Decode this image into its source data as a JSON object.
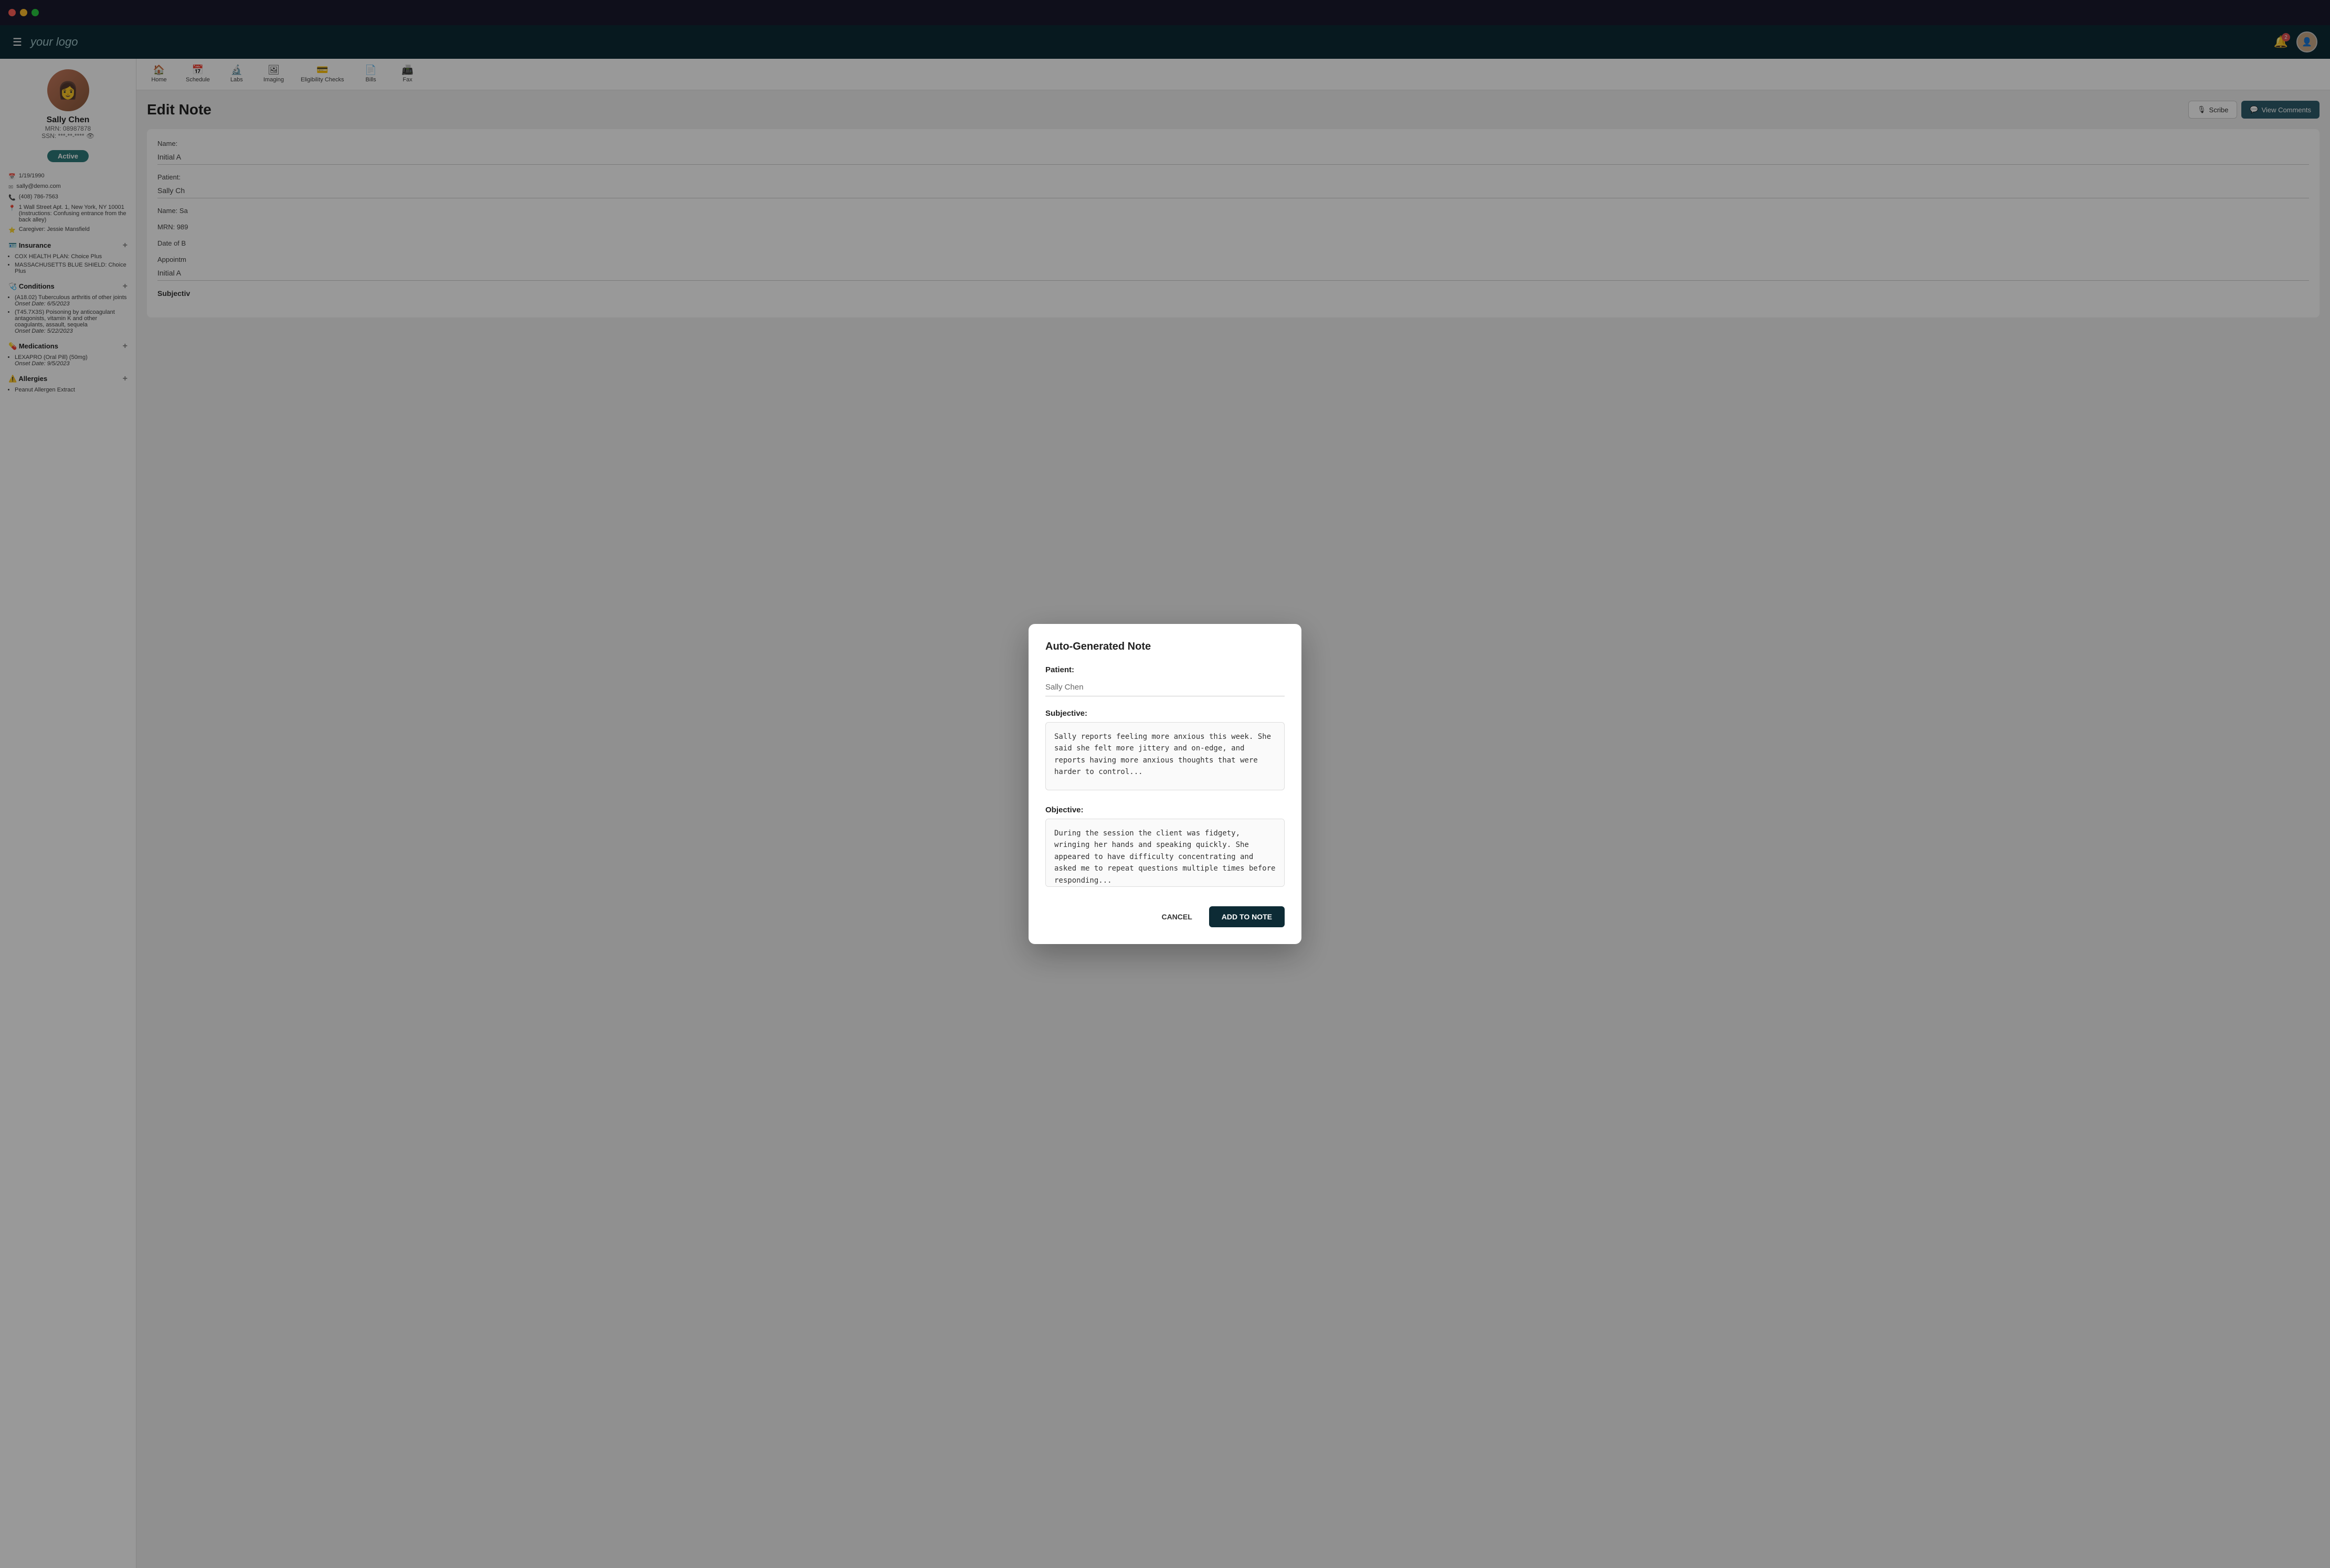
{
  "window": {
    "title": "your logo"
  },
  "titlebar": {
    "tl_red": "close",
    "tl_yellow": "minimize",
    "tl_green": "maximize"
  },
  "topnav": {
    "logo": "your logo",
    "badge_count": "2"
  },
  "sidebar": {
    "patient_avatar_emoji": "👩",
    "patient_name": "Sally Chen",
    "patient_mrn": "MRN: 08987878",
    "patient_ssn": "SSN: ***-**-****",
    "active_label": "Active",
    "dob": "1/19/1990",
    "email": "sally@demo.com",
    "phone": "(408) 786-7563",
    "address": "1 Wall Street Apt. 1, New York, NY 10001",
    "address_note": "(Instructions: Confusing entrance from the back alley)",
    "caregiver": "Caregiver: Jessie Mansfield",
    "insurance_label": "Insurance",
    "insurances": [
      "COX HEALTH PLAN: Choice Plus",
      "MASSACHUSETTS BLUE SHIELD: Choice Plus"
    ],
    "conditions_label": "Conditions",
    "conditions": [
      "(A18.02) Tuberculous arthritis of other joints\nOnset Date: 6/5/2023",
      "(T45.7X3S) Poisoning by anticoagulant antagonists, vitamin K and other coagulants, assault, sequela\nOnset Date: 5/22/2023"
    ],
    "medications_label": "Medications",
    "medications": [
      "LEXAPRO (Oral Pill) (50mg)\nOnset Date: 9/5/2023"
    ],
    "allergies_label": "Allergies",
    "allergies": [
      "Peanut Allergen Extract"
    ]
  },
  "secondary_nav": {
    "items": [
      {
        "label": "Home",
        "icon": "🏠"
      },
      {
        "label": "Schedule",
        "icon": "📅"
      },
      {
        "label": "Labs",
        "icon": "🔬"
      },
      {
        "label": "Imaging",
        "icon": "🖼"
      },
      {
        "label": "Eligibility Checks",
        "icon": "💳"
      },
      {
        "label": "Bills",
        "icon": "📄"
      },
      {
        "label": "Fax",
        "icon": "📠"
      }
    ]
  },
  "page": {
    "edit_note_title": "Edit Note",
    "scribe_label": "Scribe",
    "view_comments_label": "View Comments"
  },
  "note_form": {
    "name_label": "Name:",
    "name_value": "Initial A",
    "patient_label": "Patient:",
    "patient_value": "Sally Ch",
    "name_full_label": "Name: Sa",
    "mrn_label": "MRN: 989",
    "dob_label": "Date of B",
    "appointment_label": "Appointm",
    "appointment_value": "Initial A",
    "subjective_label": "Subjectiv"
  },
  "modal": {
    "title": "Auto-Generated Note",
    "patient_label": "Patient:",
    "patient_value": "Sally Chen",
    "subjective_label": "Subjective:",
    "subjective_text": "Sally reports feeling more anxious this week. She said she felt more jittery and on-edge, and reports having more anxious thoughts that were harder to control...",
    "objective_label": "Objective:",
    "objective_text": "During the session the client was fidgety, wringing her hands and speaking quickly. She appeared to have difficulty concentrating and asked me to repeat questions multiple times before responding...",
    "cancel_label": "CANCEL",
    "add_to_note_label": "ADD TO NOTE"
  }
}
